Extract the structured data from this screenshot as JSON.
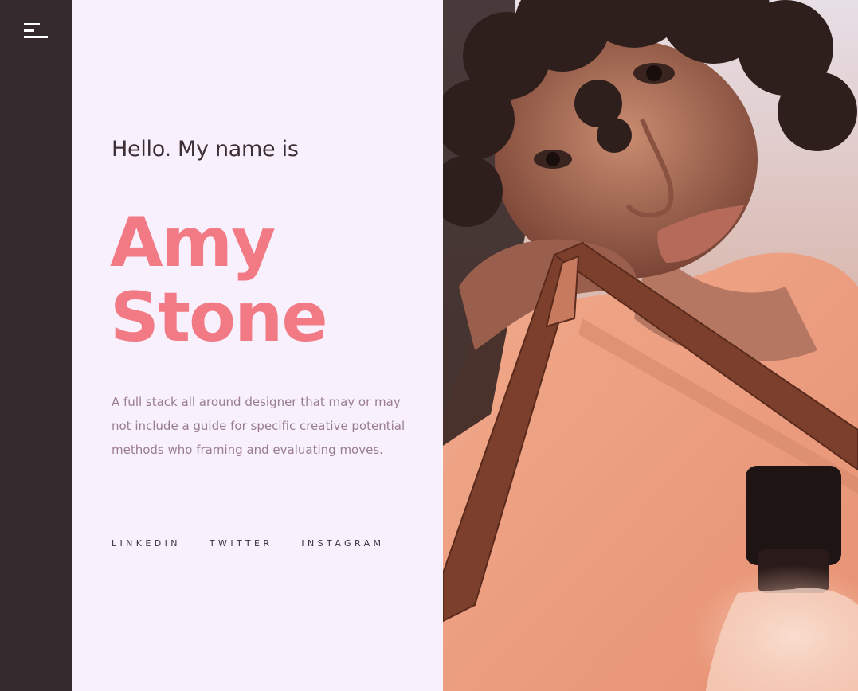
{
  "nav": {
    "menu_icon": "hamburger-menu-icon"
  },
  "hero": {
    "greeting": "Hello. My name is",
    "first_name": "Amy",
    "last_name": "Stone",
    "bio": "A full stack all around designer that may or may not include a guide for specific creative potential methods who framing and evaluating moves."
  },
  "social": {
    "links": [
      "LINKEDIN",
      "TWITTER",
      "INSTAGRAM"
    ]
  },
  "colors": {
    "accent": "#f27a84",
    "sidebar": "#342a2d",
    "background": "#f8f0fd",
    "text_dark": "#3d2f34",
    "text_muted": "#9a7d8c"
  }
}
